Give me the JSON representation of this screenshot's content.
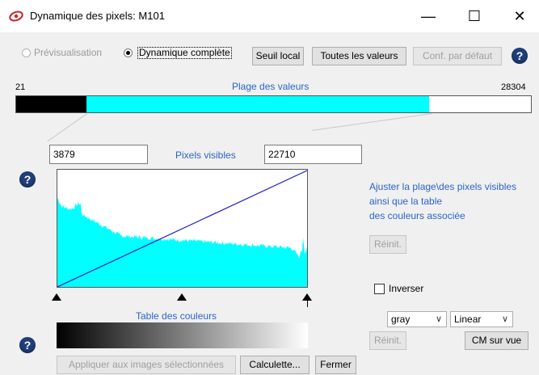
{
  "window": {
    "title": "Dynamique des pixels: M101",
    "minimize_glyph": "—",
    "maximize_glyph": "☐",
    "close_glyph": "✕"
  },
  "mode": {
    "preview_label": "Prévisualisation",
    "full_label": "Dynamique complète",
    "selected": "full"
  },
  "toolbar": {
    "local_threshold": "Seuil local",
    "all_values": "Toutes les valeurs",
    "default_conf": "Conf. par défaut",
    "help_glyph": "?"
  },
  "value_range": {
    "title": "Plage des valeurs",
    "min_label": "21",
    "max_label": "28304",
    "min": 21,
    "max": 28304,
    "visible_low": 3879,
    "visible_high": 22710,
    "fill_color": "#00ffff"
  },
  "visible_pixels": {
    "low_value": "3879",
    "label": "Pixels visibles",
    "high_value": "22710"
  },
  "description": {
    "line1": "Ajuster la plage\\des pixels visibles",
    "line2": "ainsi que la table",
    "line3": "des couleurs associée"
  },
  "reset_label": "Réinit.",
  "invert_label": "Inverser",
  "colormap": {
    "title": "Table des couleurs",
    "map_value": "gray",
    "scale_value": "Linear",
    "fit_label": "CM sur vue"
  },
  "footer": {
    "apply_label": "Appliquer aux images sélectionnées",
    "calc_label": "Calculette...",
    "close_label": "Fermer"
  },
  "histogram_color": "#00ffff",
  "transfer_line_color": "#1a1ad0"
}
